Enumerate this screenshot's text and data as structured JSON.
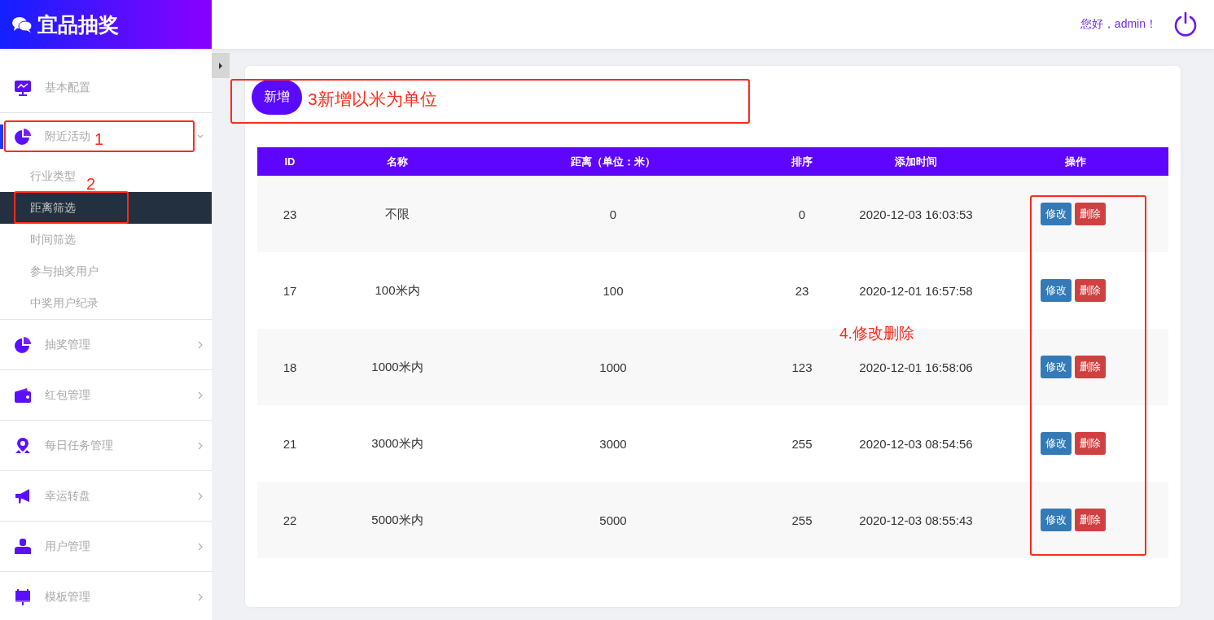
{
  "header": {
    "logo": "宜品抽奖",
    "greeting": "您好，admin！"
  },
  "sidebar": {
    "items": [
      {
        "label": "基本配置",
        "kind": "link",
        "selected": false,
        "expanded": false
      },
      {
        "label": "附近活动",
        "kind": "group",
        "selected": true,
        "expanded": true,
        "children": [
          {
            "label": "行业类型",
            "selected": false
          },
          {
            "label": "距离筛选",
            "selected": true
          },
          {
            "label": "时间筛选",
            "selected": false
          },
          {
            "label": "参与抽奖用户",
            "selected": false
          },
          {
            "label": "中奖用户纪录",
            "selected": false
          }
        ]
      },
      {
        "label": "抽奖管理",
        "kind": "group",
        "selected": false,
        "expanded": false
      },
      {
        "label": "红包管理",
        "kind": "group",
        "selected": false,
        "expanded": false
      },
      {
        "label": "每日任务管理",
        "kind": "group",
        "selected": false,
        "expanded": false
      },
      {
        "label": "幸运转盘",
        "kind": "group",
        "selected": false,
        "expanded": false
      },
      {
        "label": "用户管理",
        "kind": "group",
        "selected": false,
        "expanded": false
      },
      {
        "label": "模板管理",
        "kind": "group",
        "selected": false,
        "expanded": false
      }
    ]
  },
  "toolbar": {
    "add_button": "新增"
  },
  "table": {
    "columns": [
      "ID",
      "名称",
      "距离（单位：米）",
      "排序",
      "添加时间",
      "操作"
    ],
    "rows": [
      {
        "cells": [
          "23",
          "不限",
          "0",
          "0",
          "2020-12-03 16:03:53"
        ],
        "actions": [
          "修改",
          "删除"
        ]
      },
      {
        "cells": [
          "17",
          "100米内",
          "100",
          "23",
          "2020-12-01 16:57:58"
        ],
        "actions": [
          "修改",
          "删除"
        ]
      },
      {
        "cells": [
          "18",
          "1000米内",
          "1000",
          "123",
          "2020-12-01 16:58:06"
        ],
        "actions": [
          "修改",
          "删除"
        ]
      },
      {
        "cells": [
          "21",
          "3000米内",
          "3000",
          "255",
          "2020-12-03 08:54:56"
        ],
        "actions": [
          "修改",
          "删除"
        ]
      },
      {
        "cells": [
          "22",
          "5000米内",
          "5000",
          "255",
          "2020-12-03 08:55:43"
        ],
        "actions": [
          "修改",
          "删除"
        ]
      }
    ]
  },
  "annotations": [
    {
      "label": "1"
    },
    {
      "label": "2"
    },
    {
      "label": "3新增以米为单位"
    },
    {
      "label": "4.修改删除"
    }
  ]
}
